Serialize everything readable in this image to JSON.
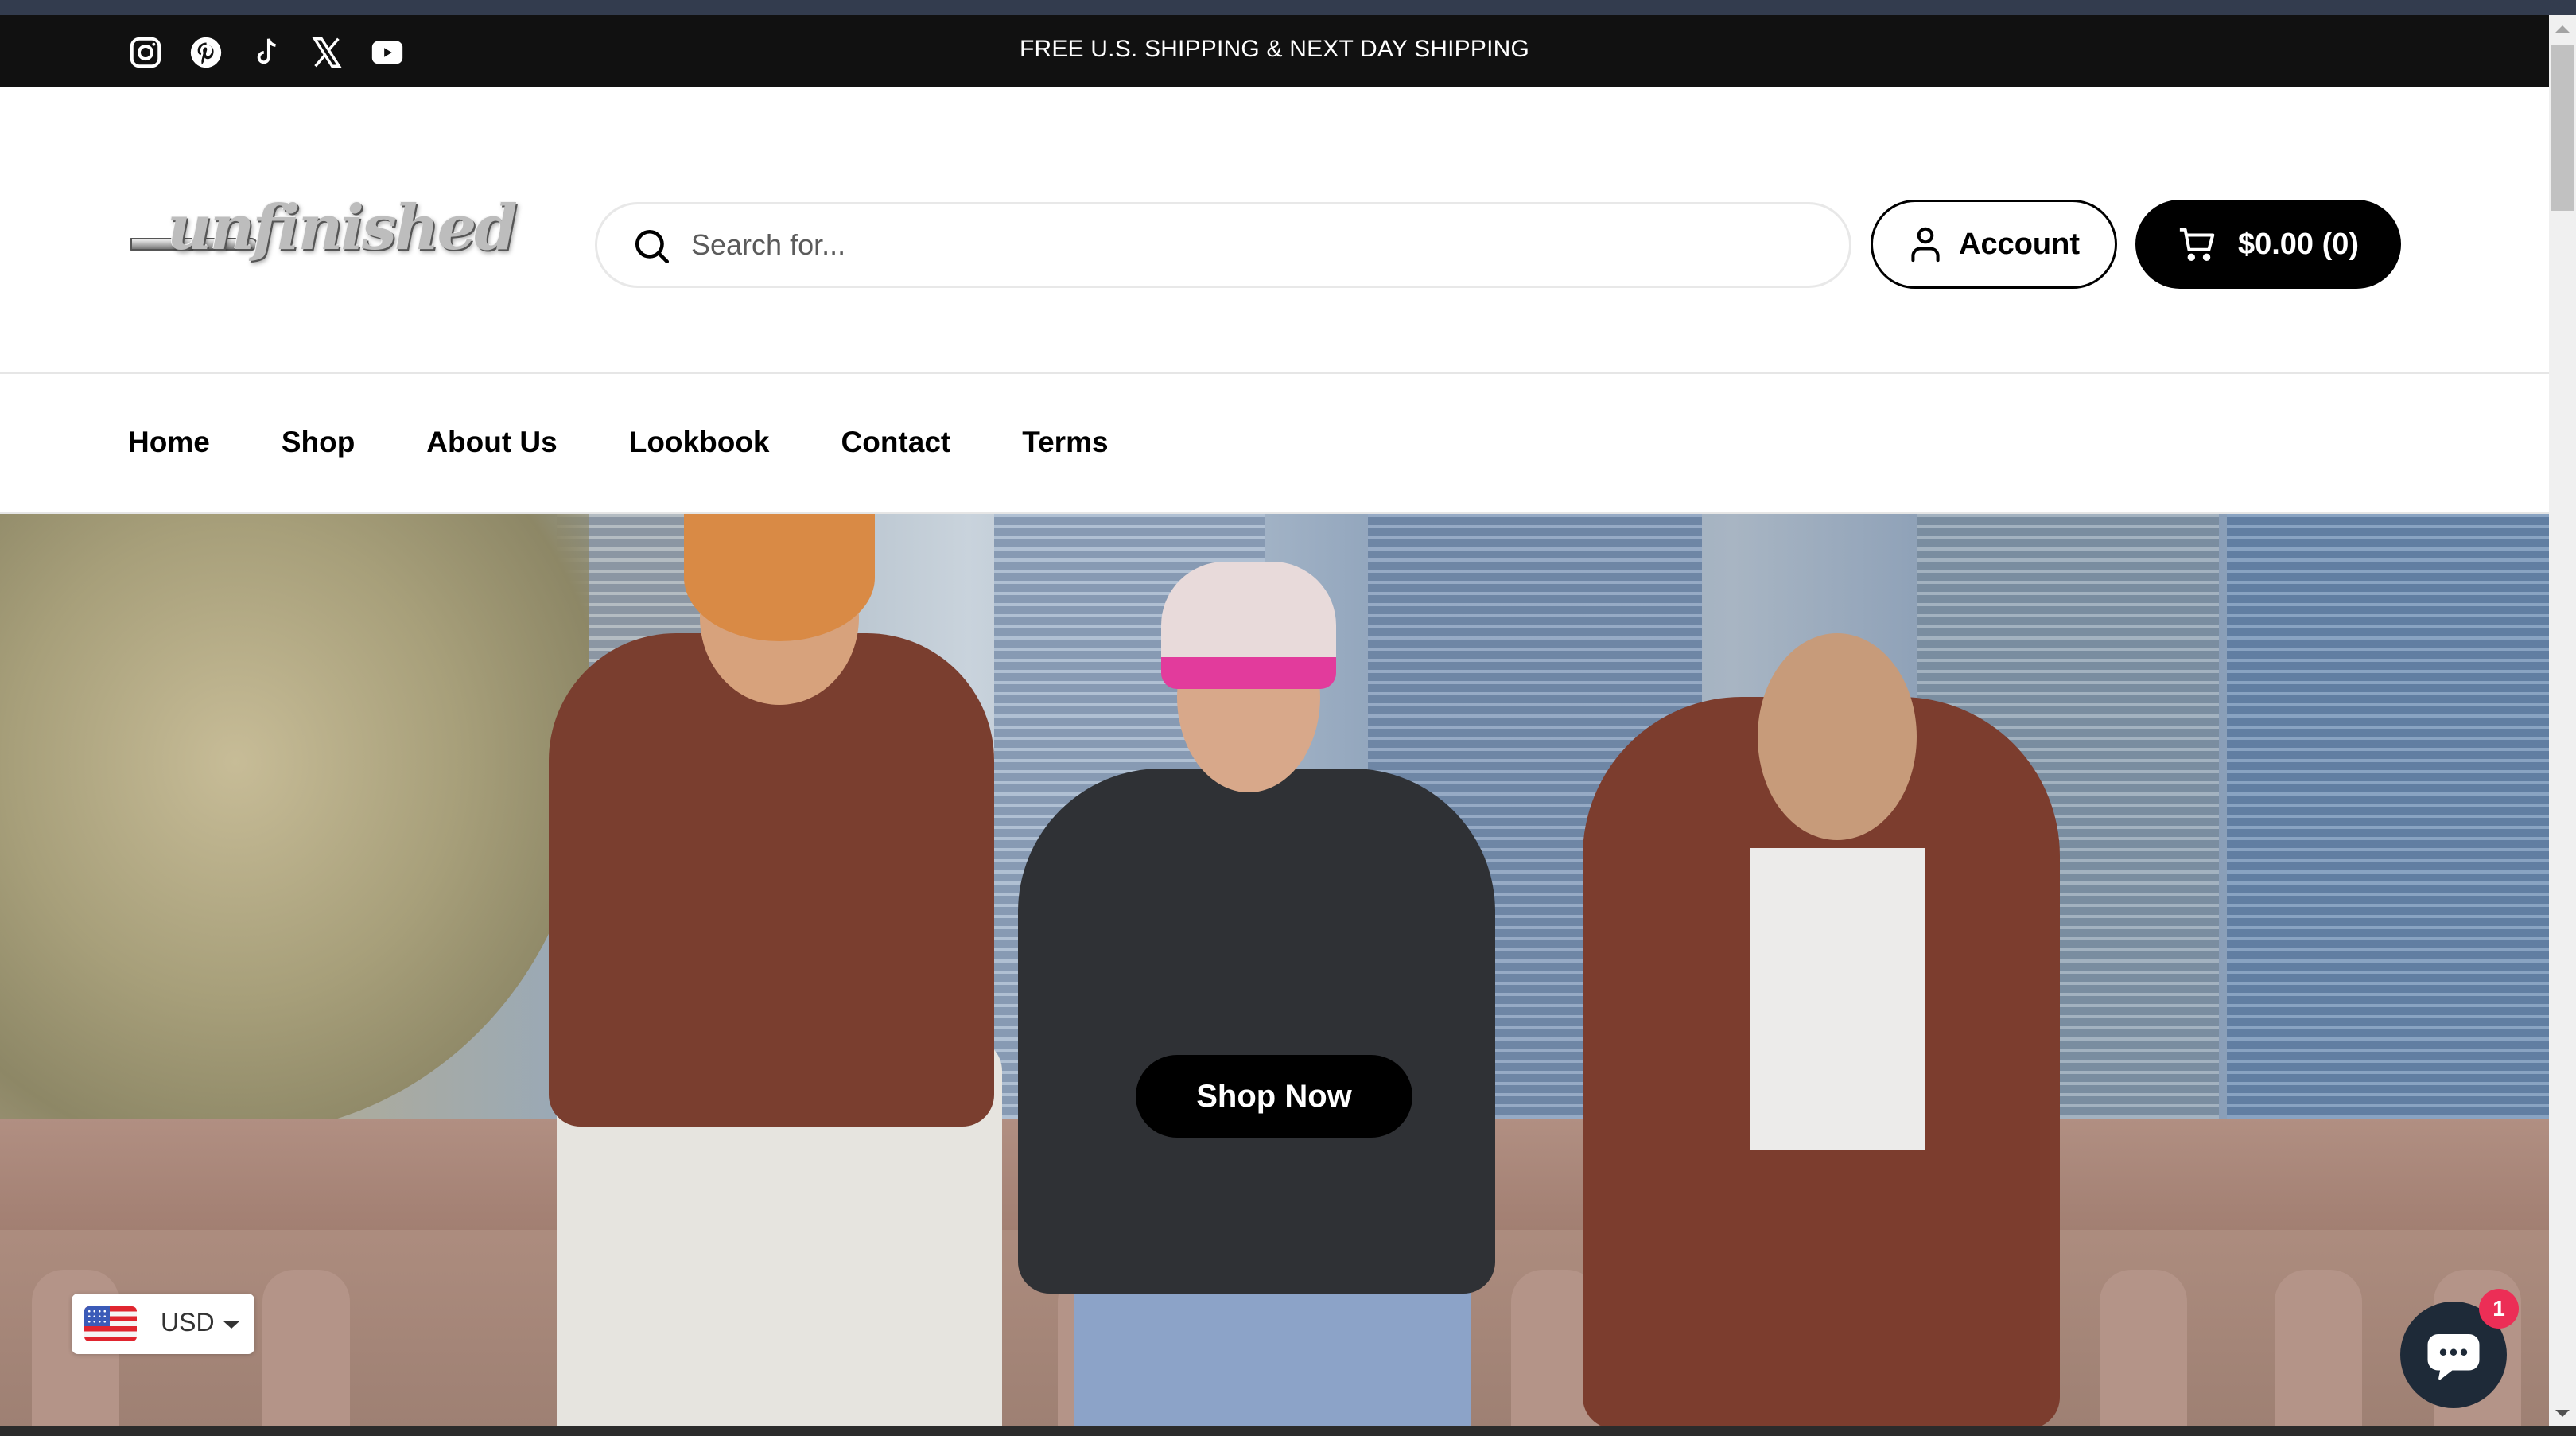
{
  "announcement": {
    "text": "FREE U.S. SHIPPING & NEXT DAY SHIPPING",
    "socials": [
      {
        "name": "instagram",
        "icon": "instagram-icon"
      },
      {
        "name": "pinterest",
        "icon": "pinterest-icon"
      },
      {
        "name": "tiktok",
        "icon": "tiktok-icon"
      },
      {
        "name": "x",
        "icon": "x-icon"
      },
      {
        "name": "youtube",
        "icon": "youtube-icon"
      }
    ]
  },
  "header": {
    "logo_text": "unfinished",
    "search": {
      "placeholder": "Search for...",
      "value": "",
      "icon": "search-icon"
    },
    "account": {
      "label": "Account",
      "icon": "user-icon"
    },
    "cart": {
      "label": "$0.00 (0)",
      "icon": "cart-icon"
    }
  },
  "nav": {
    "items": [
      {
        "label": "Home"
      },
      {
        "label": "Shop"
      },
      {
        "label": "About Us"
      },
      {
        "label": "Lookbook"
      },
      {
        "label": "Contact"
      },
      {
        "label": "Terms"
      }
    ]
  },
  "hero": {
    "cta_label": "Shop Now",
    "image_description": "Three young men in unfinished branded hoodies posed on a stone railing in front of city skyscrapers"
  },
  "currency_selector": {
    "code": "USD",
    "flag": "us-flag-icon"
  },
  "chat": {
    "badge_count": "1",
    "icon": "chat-bubble-icon"
  },
  "colors": {
    "announcement_bg": "#111111",
    "primary_button": "#000000",
    "chat_bg": "#1e2a38",
    "badge": "#ec2e56"
  }
}
